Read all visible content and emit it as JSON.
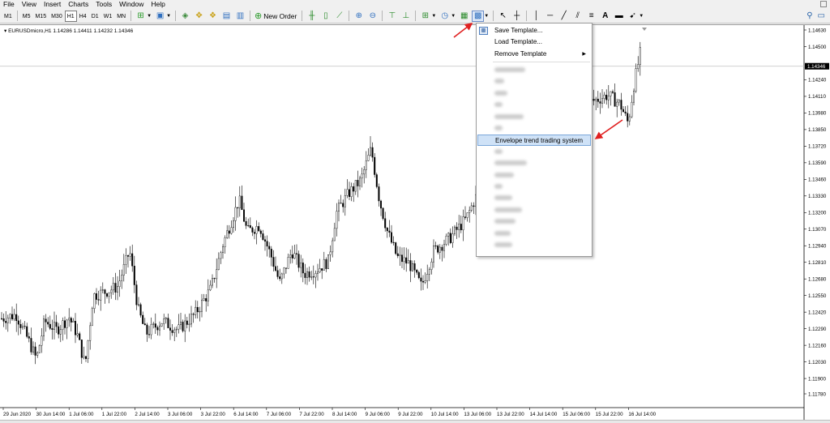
{
  "menu": [
    "File",
    "View",
    "Insert",
    "Charts",
    "Tools",
    "Window",
    "Help"
  ],
  "toolbar": {
    "timeframes": [
      "M1",
      "M5",
      "M15",
      "M30",
      "H1",
      "H4",
      "D1",
      "W1",
      "MN"
    ],
    "active_timeframe": "H1",
    "new_order_label": "New Order",
    "icons": [
      "new-chart-icon",
      "profiles-icon",
      "market-watch-icon",
      "navigator-icon",
      "terminal-icon",
      "data-window-icon",
      "strategy-tester-icon",
      "new-order-icon",
      "bar-chart-icon",
      "candlestick-icon",
      "line-chart-icon",
      "zoom-in-icon",
      "zoom-out-icon",
      "tile-icon",
      "scroll-icon",
      "shift-icon",
      "indicators-icon",
      "periods-icon",
      "templates-icon",
      "cursor-icon",
      "crosshair-icon",
      "vertical-line-icon",
      "horizontal-line-icon",
      "trend-line-icon",
      "equidistant-channel-icon",
      "fibonacci-icon",
      "text-icon",
      "text-label-icon",
      "arrows-icon"
    ]
  },
  "chart": {
    "symbol_label": "EURUSDmicro,H1  1.14286 1.14411 1.14232 1.14346",
    "current_price": "1.14346",
    "price_ticks": [
      "1.14630",
      "1.14500",
      "1.14240",
      "1.14110",
      "1.13980",
      "1.13850",
      "1.13720",
      "1.13590",
      "1.13460",
      "1.13330",
      "1.13200",
      "1.13070",
      "1.12940",
      "1.12810",
      "1.12680",
      "1.12550",
      "1.12420",
      "1.12290",
      "1.12160",
      "1.12030",
      "1.11900",
      "1.11780"
    ],
    "time_ticks": [
      "29 Jun 2020",
      "30 Jun 14:00",
      "1 Jul 06:00",
      "1 Jul 22:00",
      "2 Jul 14:00",
      "3 Jul 06:00",
      "3 Jul 22:00",
      "6 Jul 14:00",
      "7 Jul 06:00",
      "7 Jul 22:00",
      "8 Jul 14:00",
      "9 Jul 06:00",
      "9 Jul 22:00",
      "10 Jul 14:00",
      "13 Jul 06:00",
      "13 Jul 22:00",
      "14 Jul 14:00",
      "15 Jul 06:00",
      "15 Jul 22:00",
      "16 Jul 14:00"
    ],
    "colors": {
      "candle": "#000000",
      "background": "#ffffff",
      "price_line": "#c0c0c0"
    }
  },
  "template_menu": {
    "items": [
      {
        "label": "Save Template...",
        "has_icon": true
      },
      {
        "label": "Load Template...",
        "has_icon": false
      },
      {
        "label": "Remove Template",
        "has_submenu": true
      }
    ],
    "selected_label": "Envelope trend trading system"
  },
  "annotation_color": "#e02020"
}
